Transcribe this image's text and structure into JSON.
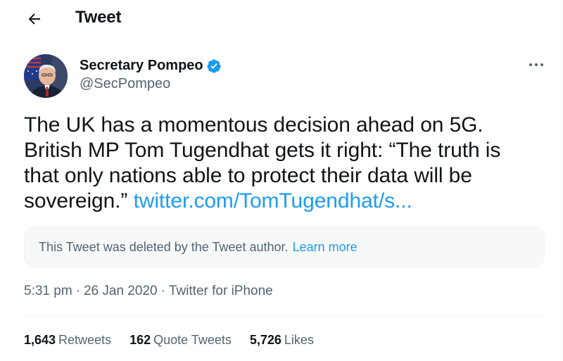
{
  "header": {
    "title": "Tweet"
  },
  "author": {
    "name": "Secretary Pompeo",
    "handle": "@SecPompeo"
  },
  "tweet": {
    "text": "The UK has a momentous decision ahead on 5G. British MP Tom Tugendhat gets it right: “The truth is that only nations able to protect their data will be sovereign.”",
    "link": "twitter.com/TomTugendhat/s..."
  },
  "quote": {
    "message": "This Tweet was deleted by the Tweet author.",
    "learn_more": "Learn more"
  },
  "meta": {
    "time": "5:31 pm",
    "date": "26 Jan 2020",
    "source": "Twitter for iPhone"
  },
  "stats": [
    {
      "count": "1,643",
      "label": "Retweets"
    },
    {
      "count": "162",
      "label": "Quote Tweets"
    },
    {
      "count": "5,726",
      "label": "Likes"
    }
  ],
  "colors": {
    "accent": "#1d9bf0",
    "text": "#0f1419",
    "secondary": "#536471"
  },
  "icons": {
    "back": "arrow-left-icon",
    "verified": "verified-badge-icon",
    "more": "more-horizontal-icon"
  }
}
